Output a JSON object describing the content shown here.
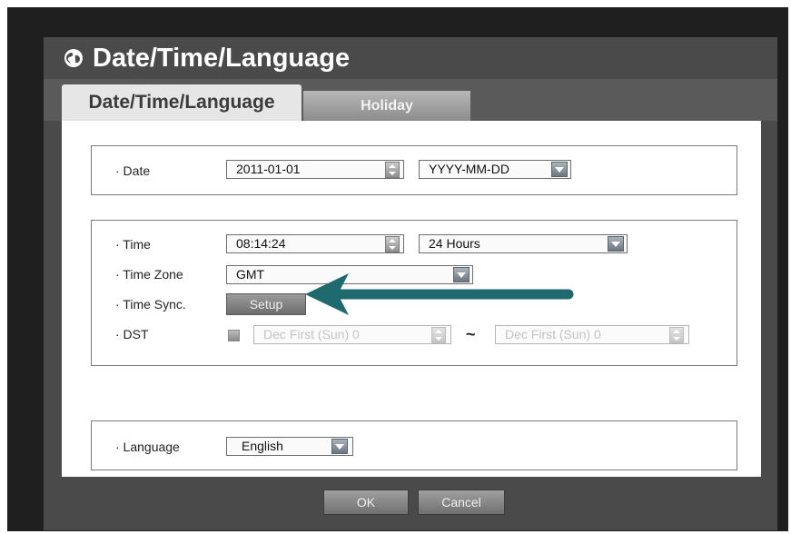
{
  "window": {
    "title": "Date/Time/Language",
    "globe_icon": "globe-icon"
  },
  "tabs": [
    {
      "label": "Date/Time/Language",
      "active": true
    },
    {
      "label": "Holiday",
      "active": false
    }
  ],
  "date_group": {
    "date_label": "· Date",
    "date_value": "2011-01-01",
    "date_format": "YYYY-MM-DD"
  },
  "time_group": {
    "time_label": "· Time",
    "time_value": "08:14:24",
    "time_format": "24 Hours",
    "timezone_label": "· Time Zone",
    "timezone_value": "GMT",
    "timesync_label": "· Time Sync.",
    "setup_label": "Setup",
    "dst_label": "· DST",
    "dst_start": "Dec First (Sun) 0",
    "dst_separator": "~",
    "dst_end": "Dec First (Sun) 0"
  },
  "language_group": {
    "language_label": "· Language",
    "language_value": "English"
  },
  "footer": {
    "ok_label": "OK",
    "cancel_label": "Cancel"
  },
  "colors": {
    "frame": "#1f1f1f",
    "window": "#4a4a4a",
    "arrow": "#1f6a6e"
  }
}
